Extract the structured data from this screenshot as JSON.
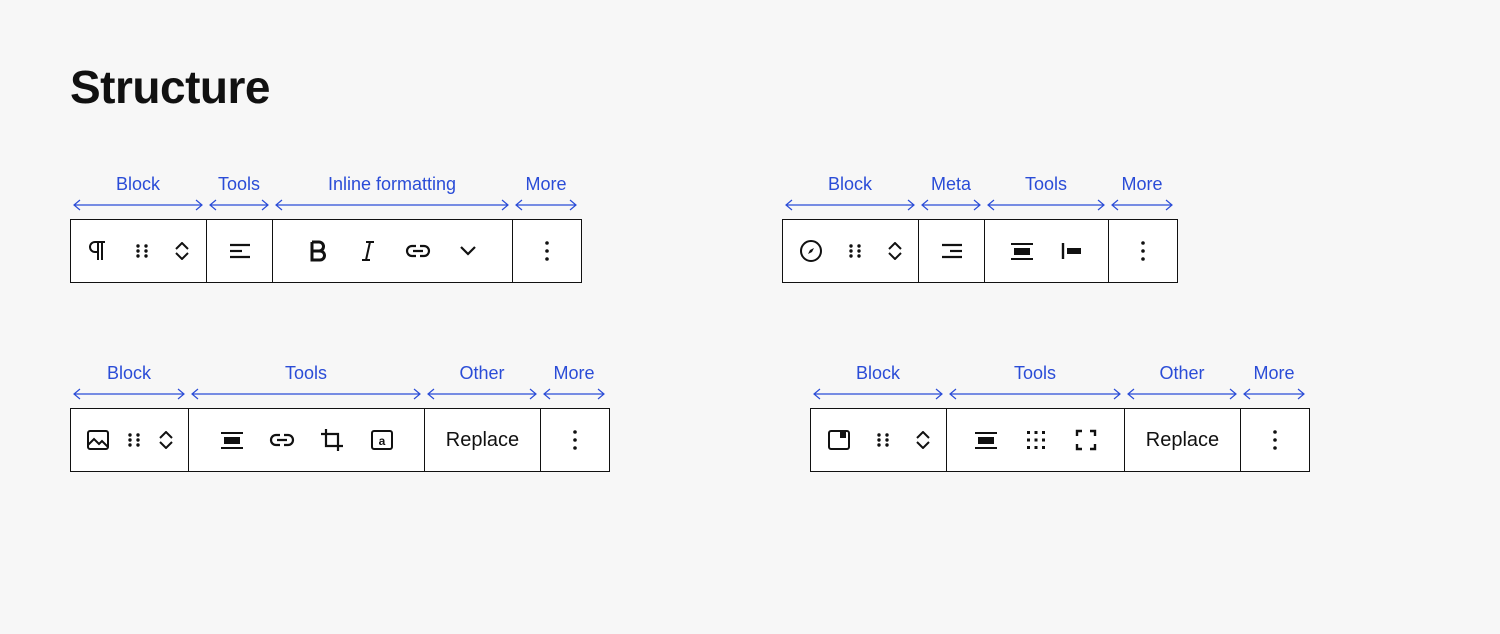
{
  "title": "Structure",
  "labels": {
    "block": "Block",
    "tools": "Tools",
    "inline": "Inline formatting",
    "more": "More",
    "meta": "Meta",
    "other": "Other"
  },
  "buttons": {
    "replace": "Replace"
  }
}
